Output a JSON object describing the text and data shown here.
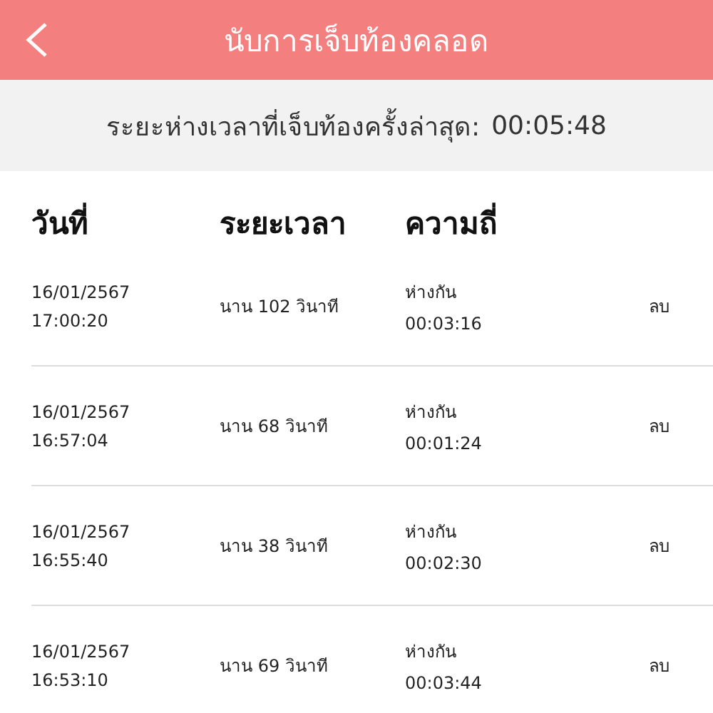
{
  "header": {
    "title": "นับการเจ็บท้องคลอด"
  },
  "summary": {
    "label": "ระยะห่างเวลาที่เจ็บท้องครั้งล่าสุด:",
    "value": "00:05:48"
  },
  "table": {
    "columns": [
      "วันที่",
      "ระยะเวลา",
      "ความถี่"
    ],
    "rows": [
      {
        "date": "16/01/2567",
        "time": "17:00:20",
        "duration": "นาน 102 วินาที",
        "gap_label": "ห่างกัน",
        "gap": "00:03:16",
        "action": "ลบ"
      },
      {
        "date": "16/01/2567",
        "time": "16:57:04",
        "duration": "นาน 68 วินาที",
        "gap_label": "ห่างกัน",
        "gap": "00:01:24",
        "action": "ลบ"
      },
      {
        "date": "16/01/2567",
        "time": "16:55:40",
        "duration": "นาน 38 วินาที",
        "gap_label": "ห่างกัน",
        "gap": "00:02:30",
        "action": "ลบ"
      },
      {
        "date": "16/01/2567",
        "time": "16:53:10",
        "duration": "นาน 69 วินาที",
        "gap_label": "ห่างกัน",
        "gap": "00:03:44",
        "action": "ลบ"
      }
    ]
  }
}
